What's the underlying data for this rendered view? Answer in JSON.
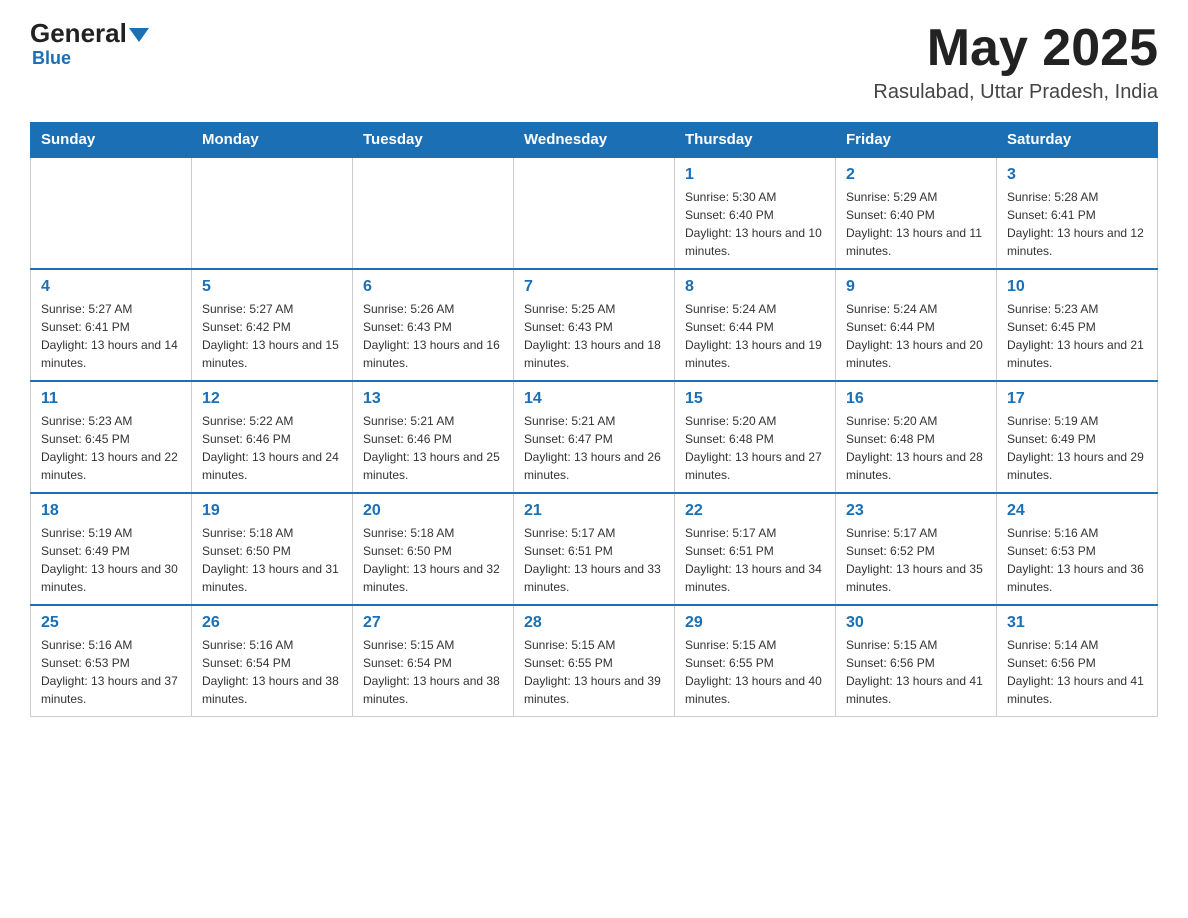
{
  "header": {
    "logo_general": "General",
    "logo_blue": "Blue",
    "month_title": "May 2025",
    "location": "Rasulabad, Uttar Pradesh, India"
  },
  "weekdays": [
    "Sunday",
    "Monday",
    "Tuesday",
    "Wednesday",
    "Thursday",
    "Friday",
    "Saturday"
  ],
  "weeks": [
    [
      {
        "day": "",
        "sunrise": "",
        "sunset": "",
        "daylight": ""
      },
      {
        "day": "",
        "sunrise": "",
        "sunset": "",
        "daylight": ""
      },
      {
        "day": "",
        "sunrise": "",
        "sunset": "",
        "daylight": ""
      },
      {
        "day": "",
        "sunrise": "",
        "sunset": "",
        "daylight": ""
      },
      {
        "day": "1",
        "sunrise": "Sunrise: 5:30 AM",
        "sunset": "Sunset: 6:40 PM",
        "daylight": "Daylight: 13 hours and 10 minutes."
      },
      {
        "day": "2",
        "sunrise": "Sunrise: 5:29 AM",
        "sunset": "Sunset: 6:40 PM",
        "daylight": "Daylight: 13 hours and 11 minutes."
      },
      {
        "day": "3",
        "sunrise": "Sunrise: 5:28 AM",
        "sunset": "Sunset: 6:41 PM",
        "daylight": "Daylight: 13 hours and 12 minutes."
      }
    ],
    [
      {
        "day": "4",
        "sunrise": "Sunrise: 5:27 AM",
        "sunset": "Sunset: 6:41 PM",
        "daylight": "Daylight: 13 hours and 14 minutes."
      },
      {
        "day": "5",
        "sunrise": "Sunrise: 5:27 AM",
        "sunset": "Sunset: 6:42 PM",
        "daylight": "Daylight: 13 hours and 15 minutes."
      },
      {
        "day": "6",
        "sunrise": "Sunrise: 5:26 AM",
        "sunset": "Sunset: 6:43 PM",
        "daylight": "Daylight: 13 hours and 16 minutes."
      },
      {
        "day": "7",
        "sunrise": "Sunrise: 5:25 AM",
        "sunset": "Sunset: 6:43 PM",
        "daylight": "Daylight: 13 hours and 18 minutes."
      },
      {
        "day": "8",
        "sunrise": "Sunrise: 5:24 AM",
        "sunset": "Sunset: 6:44 PM",
        "daylight": "Daylight: 13 hours and 19 minutes."
      },
      {
        "day": "9",
        "sunrise": "Sunrise: 5:24 AM",
        "sunset": "Sunset: 6:44 PM",
        "daylight": "Daylight: 13 hours and 20 minutes."
      },
      {
        "day": "10",
        "sunrise": "Sunrise: 5:23 AM",
        "sunset": "Sunset: 6:45 PM",
        "daylight": "Daylight: 13 hours and 21 minutes."
      }
    ],
    [
      {
        "day": "11",
        "sunrise": "Sunrise: 5:23 AM",
        "sunset": "Sunset: 6:45 PM",
        "daylight": "Daylight: 13 hours and 22 minutes."
      },
      {
        "day": "12",
        "sunrise": "Sunrise: 5:22 AM",
        "sunset": "Sunset: 6:46 PM",
        "daylight": "Daylight: 13 hours and 24 minutes."
      },
      {
        "day": "13",
        "sunrise": "Sunrise: 5:21 AM",
        "sunset": "Sunset: 6:46 PM",
        "daylight": "Daylight: 13 hours and 25 minutes."
      },
      {
        "day": "14",
        "sunrise": "Sunrise: 5:21 AM",
        "sunset": "Sunset: 6:47 PM",
        "daylight": "Daylight: 13 hours and 26 minutes."
      },
      {
        "day": "15",
        "sunrise": "Sunrise: 5:20 AM",
        "sunset": "Sunset: 6:48 PM",
        "daylight": "Daylight: 13 hours and 27 minutes."
      },
      {
        "day": "16",
        "sunrise": "Sunrise: 5:20 AM",
        "sunset": "Sunset: 6:48 PM",
        "daylight": "Daylight: 13 hours and 28 minutes."
      },
      {
        "day": "17",
        "sunrise": "Sunrise: 5:19 AM",
        "sunset": "Sunset: 6:49 PM",
        "daylight": "Daylight: 13 hours and 29 minutes."
      }
    ],
    [
      {
        "day": "18",
        "sunrise": "Sunrise: 5:19 AM",
        "sunset": "Sunset: 6:49 PM",
        "daylight": "Daylight: 13 hours and 30 minutes."
      },
      {
        "day": "19",
        "sunrise": "Sunrise: 5:18 AM",
        "sunset": "Sunset: 6:50 PM",
        "daylight": "Daylight: 13 hours and 31 minutes."
      },
      {
        "day": "20",
        "sunrise": "Sunrise: 5:18 AM",
        "sunset": "Sunset: 6:50 PM",
        "daylight": "Daylight: 13 hours and 32 minutes."
      },
      {
        "day": "21",
        "sunrise": "Sunrise: 5:17 AM",
        "sunset": "Sunset: 6:51 PM",
        "daylight": "Daylight: 13 hours and 33 minutes."
      },
      {
        "day": "22",
        "sunrise": "Sunrise: 5:17 AM",
        "sunset": "Sunset: 6:51 PM",
        "daylight": "Daylight: 13 hours and 34 minutes."
      },
      {
        "day": "23",
        "sunrise": "Sunrise: 5:17 AM",
        "sunset": "Sunset: 6:52 PM",
        "daylight": "Daylight: 13 hours and 35 minutes."
      },
      {
        "day": "24",
        "sunrise": "Sunrise: 5:16 AM",
        "sunset": "Sunset: 6:53 PM",
        "daylight": "Daylight: 13 hours and 36 minutes."
      }
    ],
    [
      {
        "day": "25",
        "sunrise": "Sunrise: 5:16 AM",
        "sunset": "Sunset: 6:53 PM",
        "daylight": "Daylight: 13 hours and 37 minutes."
      },
      {
        "day": "26",
        "sunrise": "Sunrise: 5:16 AM",
        "sunset": "Sunset: 6:54 PM",
        "daylight": "Daylight: 13 hours and 38 minutes."
      },
      {
        "day": "27",
        "sunrise": "Sunrise: 5:15 AM",
        "sunset": "Sunset: 6:54 PM",
        "daylight": "Daylight: 13 hours and 38 minutes."
      },
      {
        "day": "28",
        "sunrise": "Sunrise: 5:15 AM",
        "sunset": "Sunset: 6:55 PM",
        "daylight": "Daylight: 13 hours and 39 minutes."
      },
      {
        "day": "29",
        "sunrise": "Sunrise: 5:15 AM",
        "sunset": "Sunset: 6:55 PM",
        "daylight": "Daylight: 13 hours and 40 minutes."
      },
      {
        "day": "30",
        "sunrise": "Sunrise: 5:15 AM",
        "sunset": "Sunset: 6:56 PM",
        "daylight": "Daylight: 13 hours and 41 minutes."
      },
      {
        "day": "31",
        "sunrise": "Sunrise: 5:14 AM",
        "sunset": "Sunset: 6:56 PM",
        "daylight": "Daylight: 13 hours and 41 minutes."
      }
    ]
  ]
}
